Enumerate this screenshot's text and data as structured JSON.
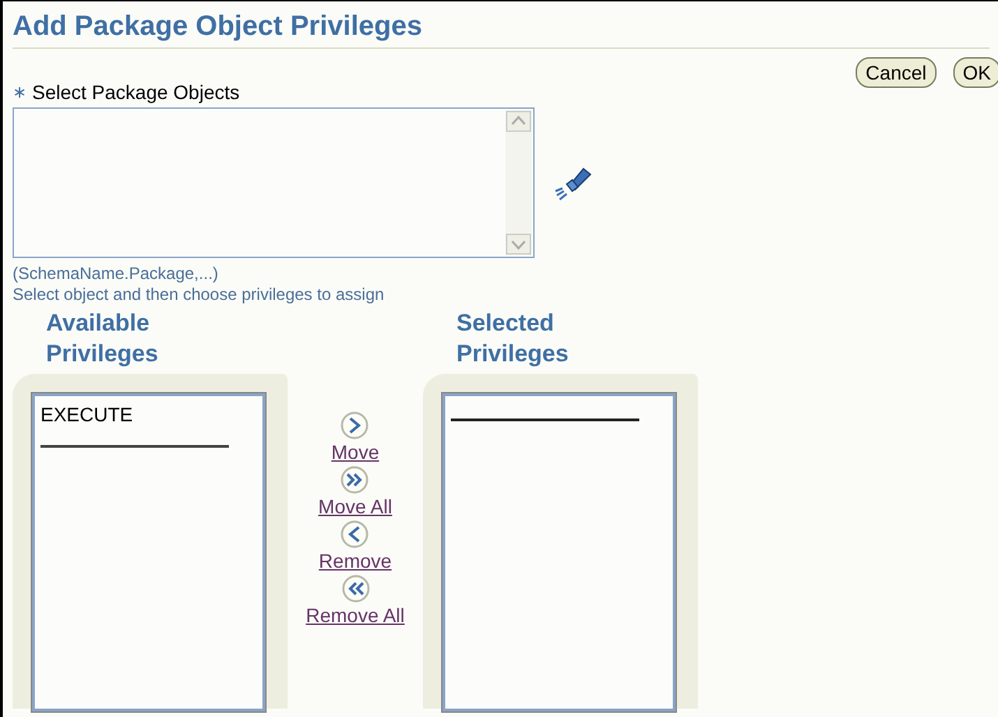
{
  "title": "Add Package Object Privileges",
  "buttons": [
    "Cancel",
    "OK"
  ],
  "field": {
    "required_mark": "∗",
    "label": "Select Package Objects",
    "hint": "(SchemaName.Package,...)"
  },
  "instruction": "Select object and then choose privileges to assign",
  "available": {
    "heading": [
      "Available",
      "Privileges"
    ],
    "items": [
      "EXECUTE"
    ]
  },
  "selected": {
    "heading": [
      "Selected",
      "Privileges"
    ]
  },
  "shuttle_actions": [
    {
      "kind": "move",
      "label": "Move"
    },
    {
      "kind": "move_all",
      "label": "Move All"
    },
    {
      "kind": "remove",
      "label": "Remove"
    },
    {
      "kind": "remove_all",
      "label": "Remove All"
    }
  ]
}
